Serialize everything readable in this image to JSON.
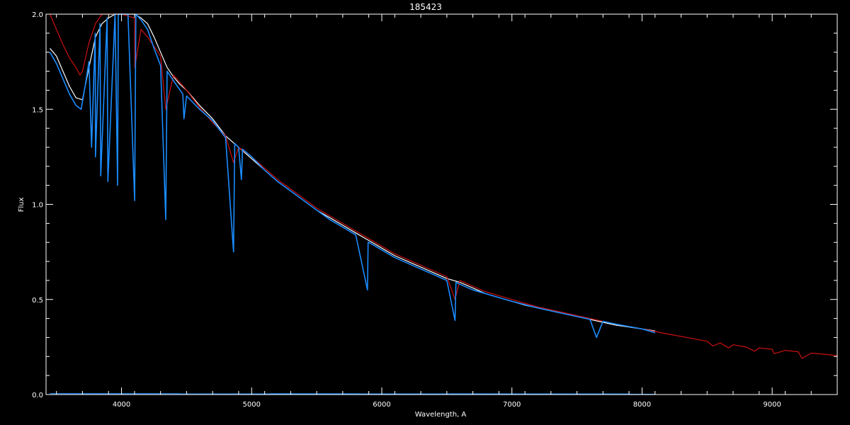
{
  "colors": {
    "background": "#000000",
    "axes": "#ffffff",
    "observed": "#ffffff",
    "model": "#cc1111",
    "fit": "#1a8cff"
  },
  "chart_data": {
    "type": "line",
    "title": "185423",
    "xlabel": "Wavelength, A",
    "ylabel": "Flux",
    "xlim": [
      3420,
      9500
    ],
    "ylim": [
      0,
      2
    ],
    "x_ticks": [
      4000,
      5000,
      6000,
      7000,
      8000,
      9000
    ],
    "x_tick_labels": [
      "4000",
      "5000",
      "6000",
      "7000",
      "8000",
      "9000"
    ],
    "y_ticks": [
      0,
      0.5,
      1,
      1.5,
      2
    ],
    "y_tick_labels": [
      "0.0",
      "0.5",
      "1.0",
      "1.5",
      "2.0"
    ],
    "grid": false,
    "series": [
      {
        "key": "observed",
        "color": "#ffffff",
        "x": [
          3450,
          3500,
          3550,
          3600,
          3650,
          3700,
          3750,
          3800,
          3850,
          3900,
          3950,
          4000,
          4050,
          4100,
          4150,
          4200,
          4250,
          4300,
          4350,
          4400,
          4450,
          4500,
          4600,
          4700,
          4800,
          4850,
          4900,
          5000,
          5100,
          5200,
          5300,
          5400,
          5500,
          5600,
          5700,
          5800,
          5900,
          6000,
          6100,
          6200,
          6300,
          6400,
          6500,
          6600,
          6700,
          6800,
          6900,
          7000,
          7100,
          7200,
          7300,
          7400,
          7500,
          7600,
          7700,
          7800,
          7900,
          8000,
          8100
        ],
        "y": [
          1.82,
          1.78,
          1.7,
          1.62,
          1.56,
          1.55,
          1.72,
          1.88,
          1.95,
          1.98,
          2.0,
          2.0,
          2.0,
          2.0,
          1.98,
          1.95,
          1.88,
          1.8,
          1.72,
          1.67,
          1.63,
          1.6,
          1.52,
          1.45,
          1.36,
          1.33,
          1.3,
          1.24,
          1.18,
          1.12,
          1.07,
          1.02,
          0.97,
          0.93,
          0.89,
          0.85,
          0.81,
          0.77,
          0.73,
          0.7,
          0.67,
          0.64,
          0.61,
          0.59,
          0.56,
          0.53,
          0.51,
          0.49,
          0.47,
          0.455,
          0.44,
          0.425,
          0.41,
          0.395,
          0.38,
          0.365,
          0.355,
          0.345,
          0.335
        ]
      },
      {
        "key": "model",
        "color": "#cc1111",
        "x": [
          3450,
          3500,
          3550,
          3600,
          3650,
          3680,
          3700,
          3750,
          3800,
          3850,
          3900,
          3950,
          4000,
          4100,
          4102,
          4150,
          4200,
          4300,
          4340,
          4400,
          4500,
          4600,
          4700,
          4800,
          4861,
          4900,
          5000,
          5100,
          5200,
          5300,
          5400,
          5500,
          5600,
          5700,
          5800,
          5900,
          6000,
          6100,
          6200,
          6300,
          6400,
          6500,
          6563,
          6600,
          6700,
          6800,
          6900,
          7000,
          7200,
          7400,
          7600,
          7800,
          8000,
          8200,
          8400,
          8500,
          8545,
          8600,
          8665,
          8700,
          8750,
          8800,
          8863,
          8900,
          9000,
          9015,
          9100,
          9200,
          9229,
          9300,
          9400,
          9500
        ],
        "y": [
          2.0,
          1.92,
          1.84,
          1.77,
          1.72,
          1.68,
          1.7,
          1.85,
          1.95,
          2.0,
          2.0,
          2.0,
          2.0,
          1.98,
          1.72,
          1.92,
          1.88,
          1.78,
          1.5,
          1.68,
          1.6,
          1.51,
          1.43,
          1.36,
          1.22,
          1.3,
          1.25,
          1.19,
          1.13,
          1.08,
          1.03,
          0.98,
          0.94,
          0.9,
          0.86,
          0.82,
          0.78,
          0.74,
          0.71,
          0.68,
          0.65,
          0.62,
          0.5,
          0.6,
          0.57,
          0.54,
          0.52,
          0.5,
          0.46,
          0.43,
          0.4,
          0.37,
          0.345,
          0.318,
          0.293,
          0.28,
          0.255,
          0.272,
          0.245,
          0.262,
          0.256,
          0.25,
          0.228,
          0.245,
          0.238,
          0.215,
          0.232,
          0.225,
          0.19,
          0.218,
          0.212,
          0.205
        ]
      },
      {
        "key": "fit",
        "color": "#1a8cff",
        "x": [
          3450,
          3500,
          3550,
          3600,
          3650,
          3690,
          3720,
          3750,
          3770,
          3798,
          3800,
          3835,
          3840,
          3889,
          3895,
          3950,
          3970,
          3975,
          4000,
          4050,
          4101,
          4110,
          4150,
          4200,
          4250,
          4300,
          4340,
          4350,
          4400,
          4471,
          4480,
          4500,
          4600,
          4700,
          4800,
          4861,
          4870,
          4900,
          4921,
          4930,
          5000,
          5100,
          5200,
          5300,
          5400,
          5500,
          5600,
          5700,
          5800,
          5890,
          5895,
          5900,
          6000,
          6100,
          6200,
          6300,
          6400,
          6500,
          6563,
          6570,
          6600,
          6700,
          6800,
          6900,
          7000,
          7200,
          7400,
          7600,
          7650,
          7700,
          7800,
          8000,
          8100
        ],
        "y": [
          1.8,
          1.74,
          1.66,
          1.58,
          1.52,
          1.5,
          1.62,
          1.75,
          1.3,
          1.9,
          1.25,
          1.95,
          1.15,
          1.98,
          1.12,
          2.0,
          1.1,
          2.0,
          2.0,
          2.0,
          1.02,
          2.0,
          1.97,
          1.92,
          1.82,
          1.73,
          0.92,
          1.7,
          1.65,
          1.58,
          1.45,
          1.57,
          1.5,
          1.44,
          1.35,
          0.75,
          1.32,
          1.3,
          1.13,
          1.29,
          1.25,
          1.18,
          1.12,
          1.07,
          1.02,
          0.97,
          0.92,
          0.88,
          0.84,
          0.55,
          0.8,
          0.8,
          0.76,
          0.72,
          0.69,
          0.66,
          0.63,
          0.6,
          0.39,
          0.59,
          0.58,
          0.55,
          0.53,
          0.51,
          0.49,
          0.455,
          0.425,
          0.395,
          0.3,
          0.385,
          0.37,
          0.345,
          0.325
        ]
      },
      {
        "key": "baseline",
        "color": "#1a8cff",
        "x": [
          3450,
          8100
        ],
        "y": [
          0.005,
          0.003
        ]
      }
    ]
  }
}
